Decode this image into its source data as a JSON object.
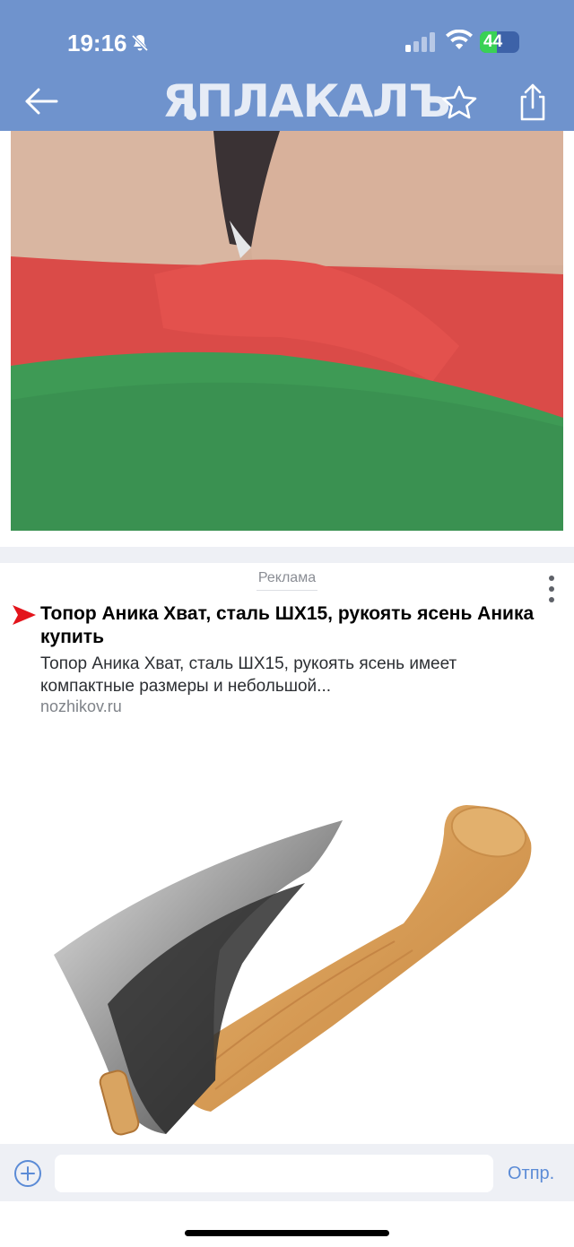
{
  "status_bar": {
    "time": "19:16",
    "battery": "44",
    "battery_level": 0.44
  },
  "header": {
    "logo": "ЯПЛАКАЛЪ"
  },
  "ad": {
    "label": "Реклама",
    "title": "Топор Аника Хват, сталь ШХ15, рукоять ясень Аника купить",
    "description": "Топор Аника Хват, сталь ШХ15, рукоять ясень имеет компактные размеры и небольшой...",
    "domain": "nozhikov.ru"
  },
  "composer": {
    "placeholder": "",
    "send_label": "Отпр."
  },
  "colors": {
    "header": "#6f93cd",
    "accent": "#5b8bd6",
    "ad_arrow": "#e3141b"
  }
}
